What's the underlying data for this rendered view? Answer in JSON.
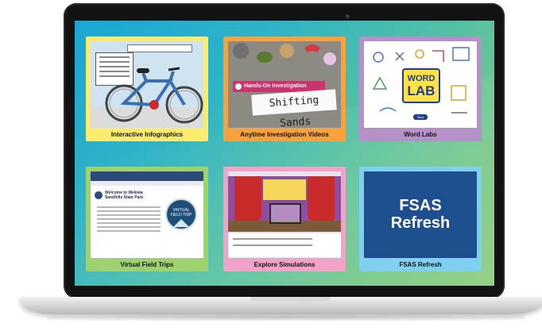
{
  "tiles": [
    {
      "label": "Interactive Infographics"
    },
    {
      "label": "Anytime Investigation Videos",
      "thumb_banner": "Hands-On Investigation",
      "thumb_card": "Shifting Sands"
    },
    {
      "label": "Word Labs",
      "logo_top": "WORD",
      "logo_bottom": "LAB",
      "button": "Start"
    },
    {
      "label": "Virtual Field Trips",
      "heading": "Welcome to Wekiwa Sandhills State Park",
      "badge_line1": "VIRTUAL",
      "badge_line2": "FIELD TRIP"
    },
    {
      "label": "Explore Simulations"
    },
    {
      "label": "FSAS Refresh",
      "title_line1": "FSAS",
      "title_line2": "Refresh"
    }
  ],
  "colors": {
    "tile1": "#fbec6f",
    "tile2": "#f7a23c",
    "tile3": "#b491c9",
    "tile4": "#9ed16f",
    "tile5": "#f1a4c7",
    "tile6": "#7fd0ee",
    "screen_gradient_start": "#1aa6d6",
    "screen_gradient_end": "#93d083"
  }
}
